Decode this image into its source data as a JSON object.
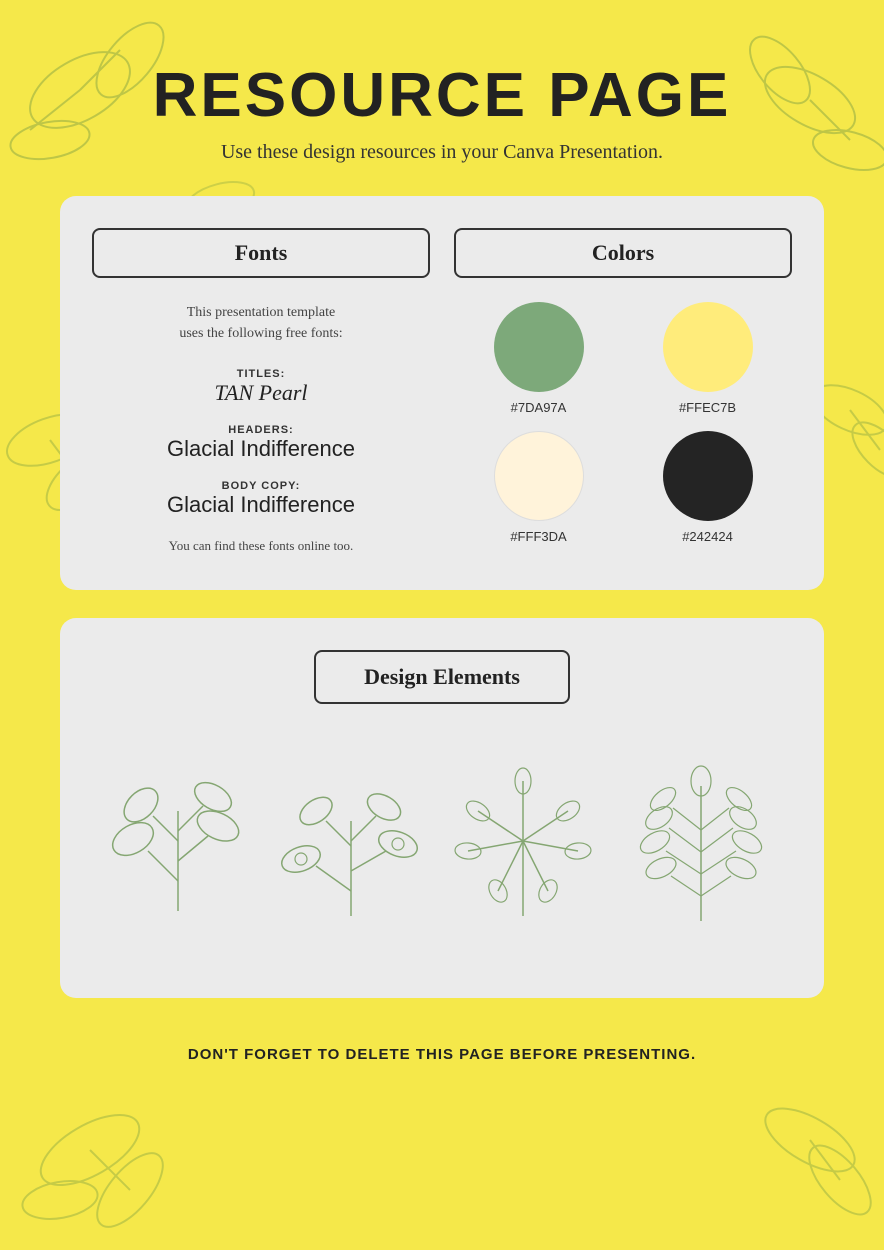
{
  "page": {
    "title": "RESOURCE PAGE",
    "subtitle": "Use these design resources in your Canva Presentation.",
    "background_color": "#F5E84A"
  },
  "fonts_section": {
    "heading": "Fonts",
    "intro_line1": "This presentation template",
    "intro_line2": "uses the following free fonts:",
    "titles_label": "TITLES:",
    "titles_font": "TAN Pearl",
    "headers_label": "HEADERS:",
    "headers_font": "Glacial Indifference",
    "body_label": "BODY COPY:",
    "body_font": "Glacial Indifference",
    "note": "You can find these fonts online too."
  },
  "colors_section": {
    "heading": "Colors",
    "swatches": [
      {
        "hex": "#7DA97A",
        "label": "#7DA97A"
      },
      {
        "hex": "#FFEC7B",
        "label": "#FFEC7B"
      },
      {
        "hex": "#FFF3DA",
        "label": "#FFF3DA"
      },
      {
        "hex": "#242424",
        "label": "#242424"
      }
    ]
  },
  "design_elements": {
    "heading": "Design Elements"
  },
  "footer": {
    "note": "DON'T FORGET TO DELETE THIS PAGE BEFORE PRESENTING."
  }
}
